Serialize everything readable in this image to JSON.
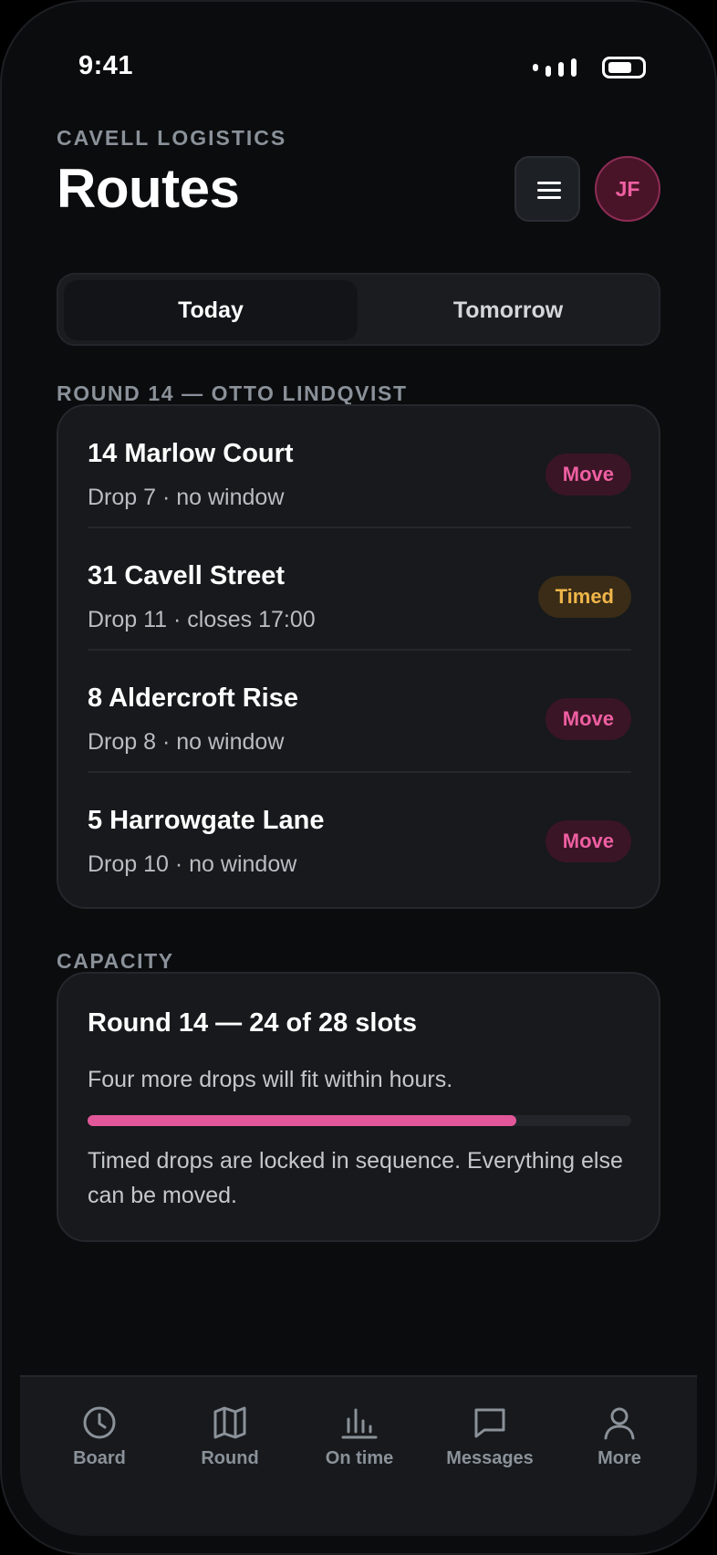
{
  "status_bar": {
    "time": "9:41"
  },
  "header": {
    "company": "CAVELL LOGISTICS",
    "title": "Routes",
    "avatar_initials": "JF"
  },
  "segment": {
    "options": [
      "Today",
      "Tomorrow"
    ],
    "selected": "Today"
  },
  "round": {
    "label": "ROUND 14 — OTTO LINDQVIST",
    "drops": [
      {
        "name": "14 Marlow Court",
        "meta": "Drop 7 · no window",
        "badge": "Move",
        "badge_type": "move"
      },
      {
        "name": "31 Cavell Street",
        "meta": "Drop 11 · closes 17:00",
        "badge": "Timed",
        "badge_type": "timed"
      },
      {
        "name": "8 Aldercroft Rise",
        "meta": "Drop 8 · no window",
        "badge": "Move",
        "badge_type": "move"
      },
      {
        "name": "5 Harrowgate Lane",
        "meta": "Drop 10 · no window",
        "badge": "Move",
        "badge_type": "move"
      }
    ]
  },
  "capacity": {
    "label": "CAPACITY",
    "title": "Round 14 — 24 of 28 slots",
    "subtitle": "Four more drops will fit within hours.",
    "used": 24,
    "total": 28,
    "note": "Timed drops are locked in sequence. Everything else can be moved."
  },
  "tabbar": {
    "items": [
      {
        "label": "Board",
        "icon": "clock-icon"
      },
      {
        "label": "Round",
        "icon": "map-icon"
      },
      {
        "label": "On time",
        "icon": "bar-chart-icon"
      },
      {
        "label": "Messages",
        "icon": "message-icon"
      },
      {
        "label": "More",
        "icon": "user-icon"
      }
    ]
  },
  "colors": {
    "accent": "#e2579a",
    "move_badge_text": "#ef5fa1",
    "timed_badge_text": "#f0b64a",
    "background": "#0b0c0e",
    "card": "#17191c"
  }
}
